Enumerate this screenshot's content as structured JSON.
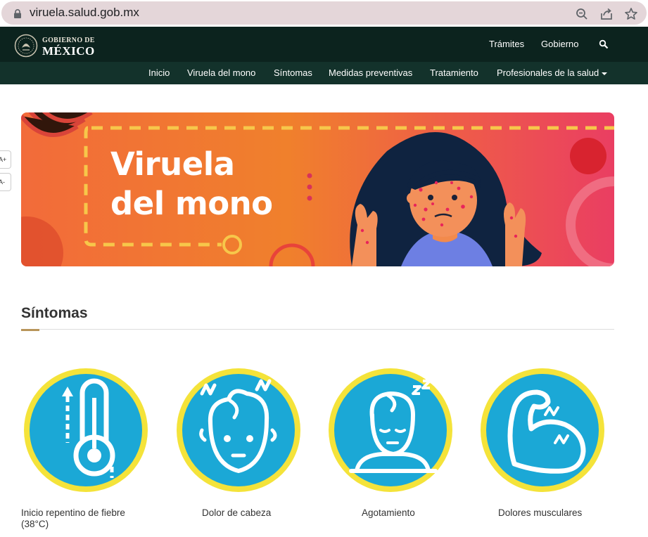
{
  "browser": {
    "url": "viruela.salud.gob.mx",
    "icons": [
      "lock-icon",
      "zoom-icon",
      "share-icon",
      "star-icon"
    ]
  },
  "header": {
    "logo_top": "GOBIERNO DE",
    "logo_main": "MÉXICO",
    "links": [
      "Trámites",
      "Gobierno"
    ],
    "search_icon": "search-icon"
  },
  "nav": {
    "items": [
      "Inicio",
      "Viruela del mono",
      "Síntomas",
      "Medidas preventivas",
      "Tratamiento",
      "Profesionales de la salud"
    ]
  },
  "accessibility": {
    "increase": "A+",
    "decrease": "A-"
  },
  "banner": {
    "title": "Viruela\ndel mono"
  },
  "symptoms_section": {
    "title": "Síntomas",
    "items": [
      {
        "label": "Inicio repentino de fiebre (38°C)",
        "icon": "thermometer-icon"
      },
      {
        "label": "Dolor de cabeza",
        "icon": "headache-icon"
      },
      {
        "label": "Agotamiento",
        "icon": "fatigue-icon"
      },
      {
        "label": "Dolores musculares",
        "icon": "muscle-pain-icon"
      }
    ]
  },
  "colors": {
    "header_bg": "#0c231e",
    "subnav_bg": "#13322b",
    "banner_orange": "#ef6c2c",
    "banner_pink": "#ec4464",
    "icon_blue": "#1ba8d6",
    "icon_ring": "#f4e33a",
    "accent_gold": "#b8955a"
  }
}
